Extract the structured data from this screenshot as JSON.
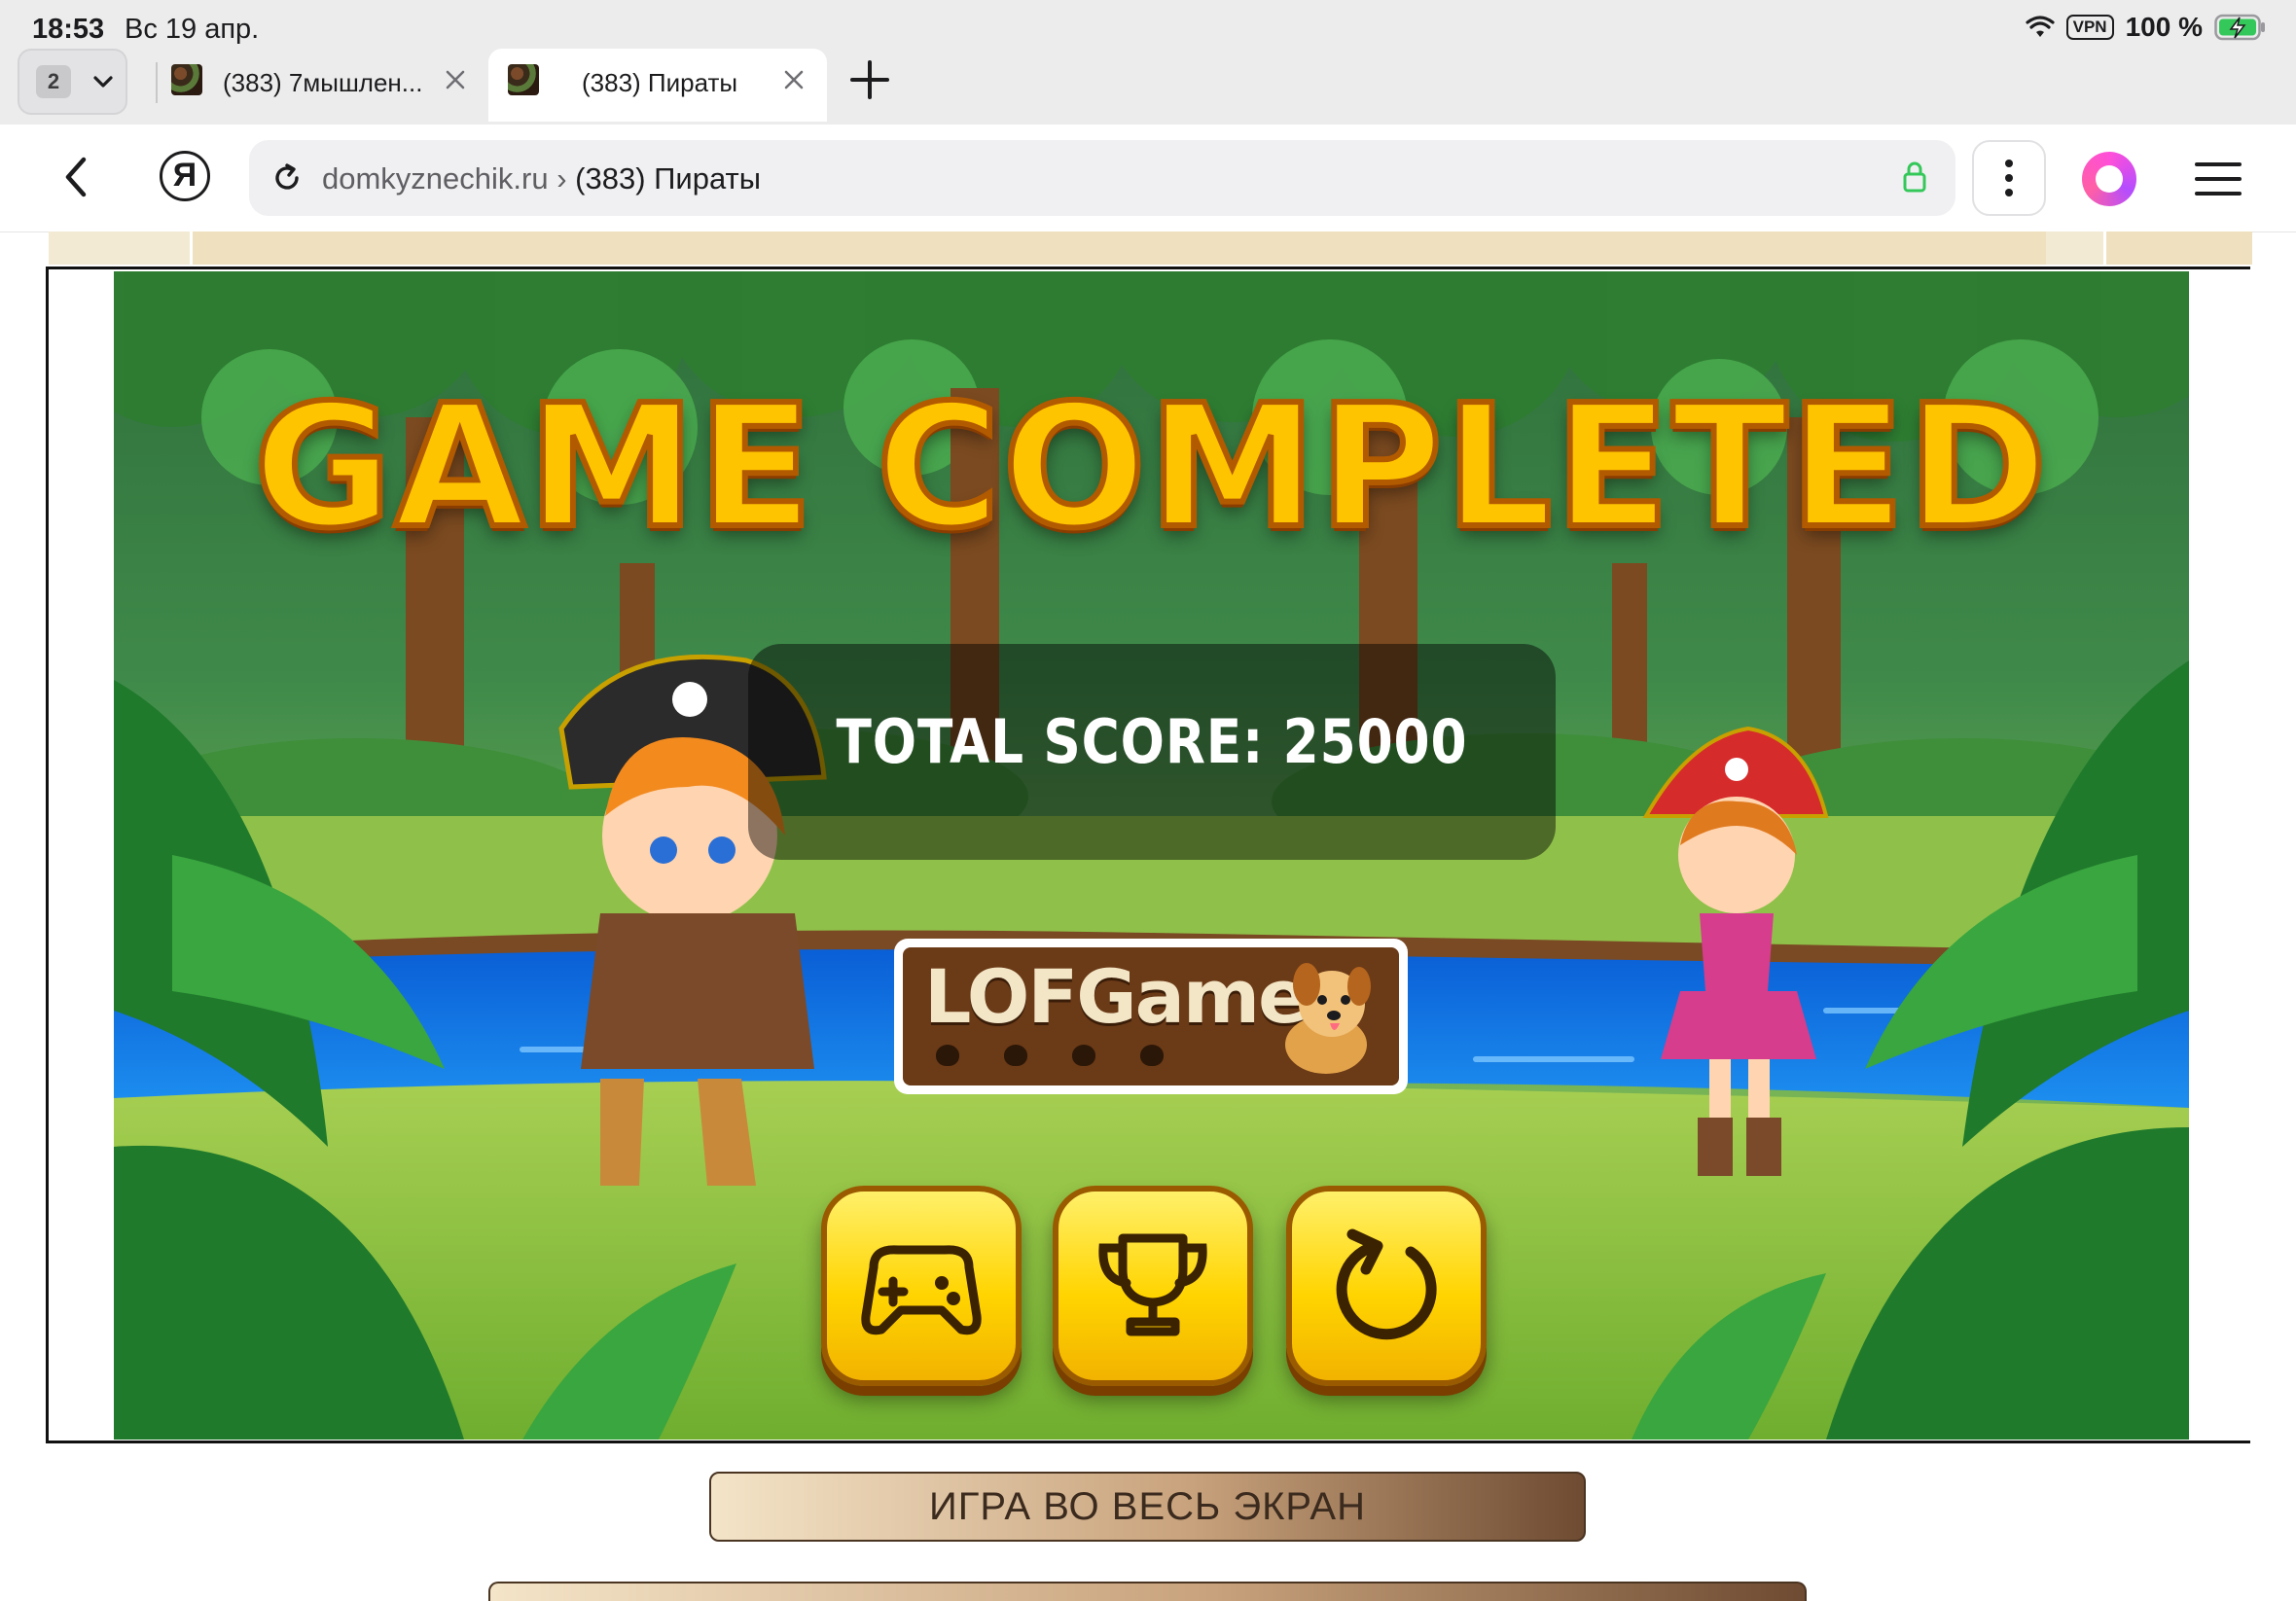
{
  "status_bar": {
    "time": "18:53",
    "date": "Вс 19 апр.",
    "vpn": "VPN",
    "battery": "100 %"
  },
  "tabs": {
    "count": "2",
    "items": [
      {
        "title": "(383) 7мышлен...",
        "active": false
      },
      {
        "title": "(383) Пираты",
        "active": true
      }
    ]
  },
  "address_bar": {
    "domain": "domkyznechik.ru",
    "separator": " › ",
    "page_title": "(383) Пираты",
    "yandex_logo": "Я"
  },
  "game": {
    "title": "GAME COMPLETED",
    "score_label": "TOTAL SCORE: 25000",
    "logo_text": "LOFGames",
    "buttons": [
      {
        "icon": "gamepad-icon"
      },
      {
        "icon": "trophy-icon"
      },
      {
        "icon": "replay-icon"
      }
    ],
    "colors": {
      "title": "#ffc400",
      "button": "#ffd400",
      "logo_bg": "#6b3a17"
    }
  },
  "page": {
    "fullscreen_label": "ИГРА ВО ВЕСЬ ЭКРАН"
  }
}
